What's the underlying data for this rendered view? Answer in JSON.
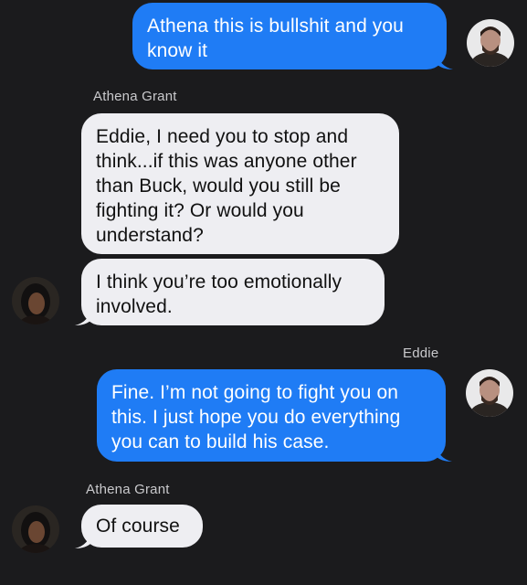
{
  "conversation": {
    "messages": [
      {
        "direction": "outgoing",
        "text": "Athena this is bullshit and you\nknow it"
      },
      {
        "sender": "Athena Grant"
      },
      {
        "direction": "incoming",
        "text": "Eddie, I need you to stop and\nthink...if this was anyone other\nthan Buck, would you still be\nfighting it? Or would you\nunderstand?"
      },
      {
        "direction": "incoming",
        "text": "I think you’re too emotionally\ninvolved."
      },
      {
        "sender": "Eddie"
      },
      {
        "direction": "outgoing",
        "text": "Fine. I’m not going to fight you on\nthis. I just hope you do everything\nyou can to build his case."
      },
      {
        "sender": "Athena Grant"
      },
      {
        "direction": "incoming",
        "text": "Of course"
      }
    ]
  },
  "colors": {
    "background": "#1b1b1d",
    "outgoing_bubble": "#1f7cf5",
    "incoming_bubble": "#eeeef2",
    "sender_label": "#c9c9cc"
  },
  "icons": {
    "eddie_avatar": "person-avatar-eddie",
    "athena_avatar": "person-avatar-athena"
  }
}
